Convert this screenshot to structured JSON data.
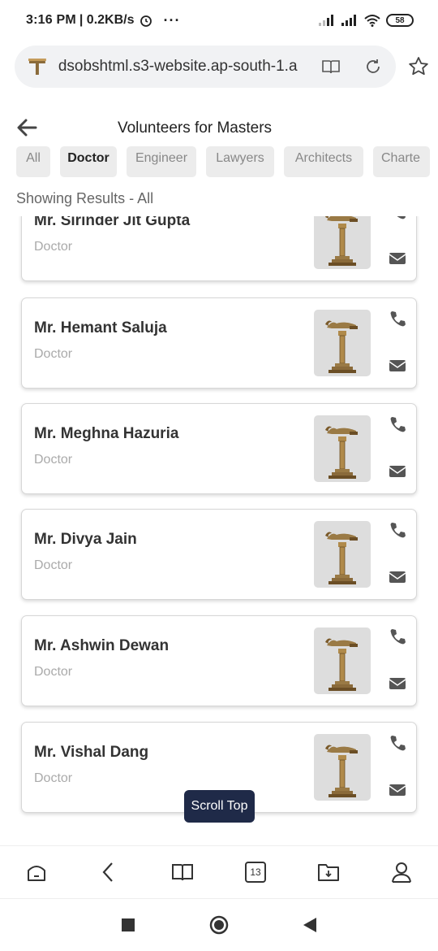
{
  "status_bar": {
    "time": "3:16 PM",
    "speed": "| 0.2KB/s",
    "more": "···",
    "battery": "58"
  },
  "address_bar": {
    "url": "dsobshtml.s3-website.ap-south-1.a"
  },
  "header": {
    "title": "Volunteers for Masters"
  },
  "categories": [
    {
      "label": "All",
      "active": false
    },
    {
      "label": "Doctor",
      "active": true
    },
    {
      "label": "Engineer",
      "active": false
    },
    {
      "label": "Lawyers",
      "active": false
    },
    {
      "label": "Architects",
      "active": false
    },
    {
      "label": "Charte",
      "active": false
    }
  ],
  "results_label": "Showing Results - All",
  "volunteers": [
    {
      "name": "Mr. Sirinder Jit Gupta",
      "profession": "Doctor"
    },
    {
      "name": "Mr. Hemant Saluja",
      "profession": "Doctor"
    },
    {
      "name": "Mr. Meghna Hazuria",
      "profession": "Doctor"
    },
    {
      "name": "Mr. Divya Jain",
      "profession": "Doctor"
    },
    {
      "name": "Mr. Ashwin Dewan",
      "profession": "Doctor"
    },
    {
      "name": "Mr. Vishal Dang",
      "profession": "Doctor"
    }
  ],
  "scroll_top_label": "Scroll Top",
  "toolbar": {
    "tab_count": "13"
  },
  "colors": {
    "accent_dark": "#1f2a48",
    "lamp_gold": "#b08a4a"
  },
  "icons": [
    "site-icon",
    "reader-mode-icon",
    "reload-icon",
    "star-icon",
    "back-arrow-icon",
    "phone-icon",
    "mail-icon",
    "home-icon",
    "book-icon",
    "download-folder-icon",
    "profile-icon"
  ]
}
